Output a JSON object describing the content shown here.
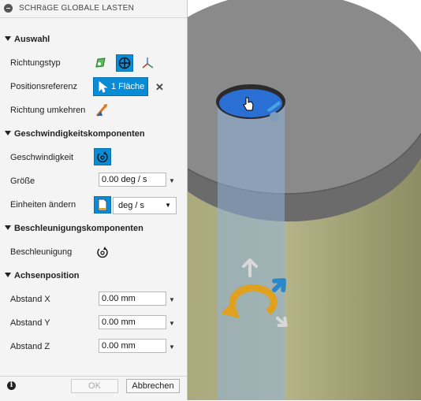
{
  "panel": {
    "title": "SCHRäGE GLOBALE LASTEN",
    "sections": {
      "auswahl": "Auswahl",
      "geschwindigkeit": "Geschwindigkeitskomponenten",
      "beschleunigung": "Beschleunigungskomponenten",
      "achsenposition": "Achsenposition"
    },
    "labels": {
      "richtungstyp": "Richtungstyp",
      "positionsreferenz": "Positionsreferenz",
      "richtung_umkehren": "Richtung umkehren",
      "geschwindigkeit": "Geschwindigkeit",
      "groesse": "Größe",
      "einheiten_aendern": "Einheiten ändern",
      "beschleunigung": "Beschleunigung",
      "abstand_x": "Abstand X",
      "abstand_y": "Abstand Y",
      "abstand_z": "Abstand Z"
    },
    "values": {
      "selection": "1 Fläche",
      "groesse": "0.00 deg / s",
      "einheiten": "deg / s",
      "abstand_x": "0.00 mm",
      "abstand_y": "0.00 mm",
      "abstand_z": "0.00 mm"
    },
    "buttons": {
      "ok": "OK",
      "cancel": "Abbrechen",
      "clear": "✕",
      "info": "i"
    },
    "icons": {
      "richtungstyp": [
        "plane-direction-icon",
        "axis-direction-icon",
        "triad-direction-icon"
      ],
      "accent": "#0a8bd6"
    }
  },
  "viewport": {
    "colors": {
      "cylinder_side": "#9c9c6e",
      "cylinder_top": "#8a8a8a",
      "hole": "#2a6fd4",
      "axis_beam": "#8fb3d8",
      "rotation_arrow": "#e0a020"
    }
  }
}
